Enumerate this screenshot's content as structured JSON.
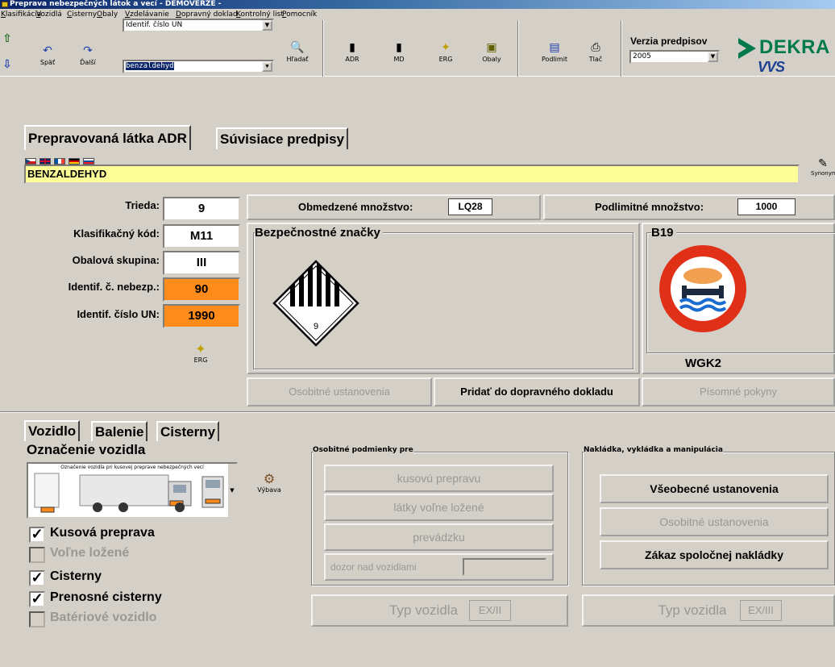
{
  "window": {
    "title": "Preprava nebezpečných látok a vecí - DEMOVERZE -"
  },
  "menu": [
    "Klasifikácia",
    "Vozidlá",
    "Cisterny",
    "Obaly",
    "Vzdelávanie",
    "Dopravný doklad",
    "Kontrolný list",
    "Pomocník"
  ],
  "toolbar": {
    "back": "Späť",
    "next": "Ďalší",
    "search_type": "Identif. číslo UN",
    "search_value": "benzaldehyd",
    "search": "Hľadať",
    "adr": "ADR",
    "md": "MD",
    "erg": "ERG",
    "packaging": "Obaly",
    "sublimit": "Podlimit",
    "print": "Tlač",
    "regulations_version_label": "Verzia predpisov",
    "regulations_version": "2005"
  },
  "logo": {
    "brand": "DEKRA",
    "sub": "VVS"
  },
  "tabs_top": {
    "active": "Prepravovaná látka ADR",
    "other": "Súvisiace predpisy"
  },
  "language_flags": [
    "CZ",
    "GB",
    "FR",
    "DE",
    "SK"
  ],
  "substance_name": "BENZALDEHYD",
  "synonyms": "Synonymá",
  "properties": [
    {
      "label": "Trieda:",
      "value": "9",
      "highlight": false
    },
    {
      "label": "Klasifikačný kód:",
      "value": "M11",
      "highlight": false
    },
    {
      "label": "Obalová skupina:",
      "value": "III",
      "highlight": false
    },
    {
      "label": "Identif. č. nebezp.:",
      "value": "90",
      "highlight": true,
      "color": "#ff8c1a"
    },
    {
      "label": "Identif. číslo UN:",
      "value": "1990",
      "highlight": true,
      "color": "#ff8c1a"
    }
  ],
  "erg_small": "ERG",
  "limited_quantity": {
    "label": "Obmedzené množstvo:",
    "value": "LQ28"
  },
  "sublimit_quantity": {
    "label": "Podlimitné množstvo:",
    "value": "1000"
  },
  "safety_signs": {
    "title": "Bezpečnostné značky",
    "class_number": "9"
  },
  "b19": {
    "title": "B19",
    "wgk": "WGK2"
  },
  "actions": {
    "special_provisions": "Osobitné ustanovenia",
    "add_to_document": "Pridať do dopravného dokladu",
    "written_instructions": "Písomné pokyny"
  },
  "tabs_bottom": [
    "Vozidlo",
    "Balenie",
    "Cisterny"
  ],
  "vehicle": {
    "marking_title": "Označenie vozidla",
    "marking_caption": "Označenie vozidla pri kusovej preprave nebezpečných vecí",
    "equipment": "Výbava",
    "checkboxes": [
      {
        "label": "Kusová preprava",
        "checked": true,
        "enabled": true
      },
      {
        "label": "Voľne ložené",
        "checked": false,
        "enabled": false
      },
      {
        "label": "Cisterny",
        "checked": true,
        "enabled": true
      },
      {
        "label": "Prenosné cisterny",
        "checked": true,
        "enabled": true
      },
      {
        "label": "Batériové vozidlo",
        "checked": false,
        "enabled": false
      }
    ]
  },
  "special_conditions": {
    "title": "Osobitné podmienky pre",
    "buttons": [
      "kusovú prepravu",
      "látky voľne ložené",
      "prevádzku",
      "dozor nad vozidlami"
    ]
  },
  "loading": {
    "title": "Nakládka, vykládka a manipulácia",
    "buttons": [
      "Všeobecné ustanovenia",
      "Osobitné ustanovenia",
      "Zákaz spoločnej nakládky"
    ]
  },
  "vehicle_type_left": {
    "label": "Typ vozidla",
    "value": "EX/II"
  },
  "vehicle_type_right": {
    "label": "Typ vozidla",
    "value": "EX/III"
  },
  "colors": {
    "highlight_orange": "#ff8c1a",
    "substance_yellow": "#ffff99",
    "sign_red": "#e03018",
    "dekra_green": "#007a4d",
    "vvs_blue": "#1c3f94"
  }
}
